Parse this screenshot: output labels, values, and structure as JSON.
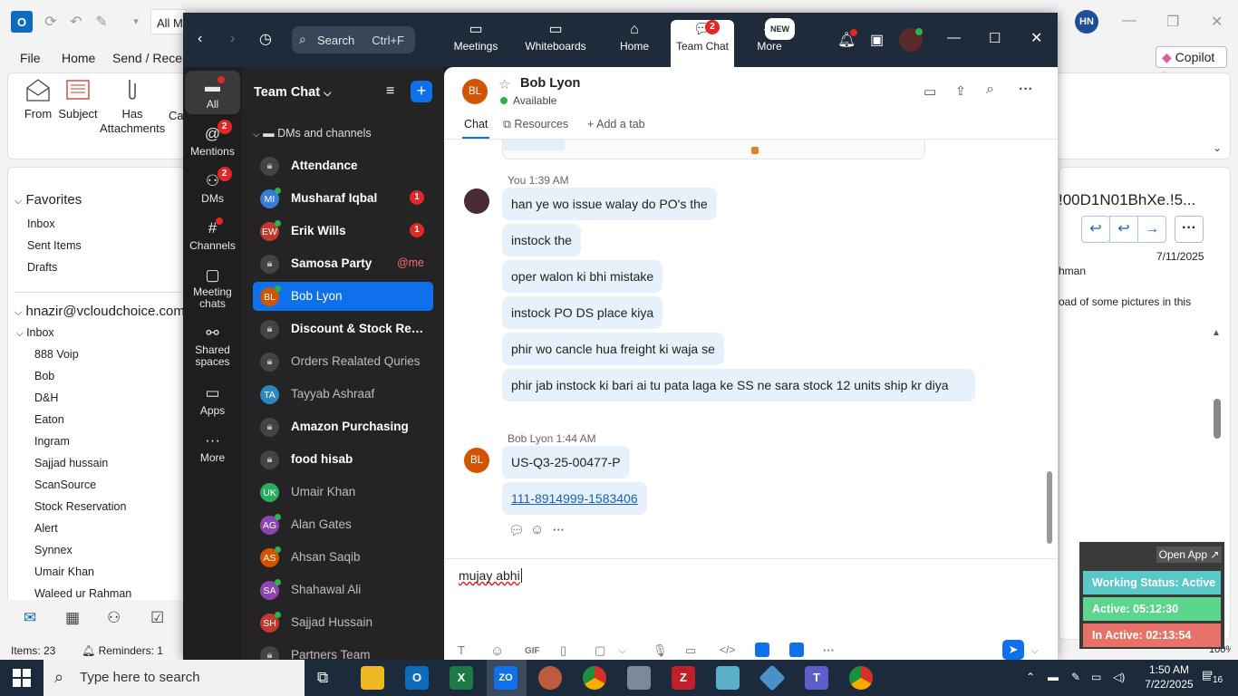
{
  "outlook": {
    "allm_text": "All M",
    "avatar_initials": "HN",
    "menu": [
      "File",
      "Home",
      "Send / Receive"
    ],
    "copilot_label": "Copilot",
    "ribbon": [
      "From",
      "Subject",
      "Has Attachments",
      "Cat"
    ],
    "favorites_label": "Favorites",
    "favorites": [
      "Inbox",
      "Sent Items",
      "Drafts"
    ],
    "account": "hnazir@vcloudchoice.com",
    "inbox_label": "Inbox",
    "folders": [
      "888 Voip",
      "Bob",
      "D&H",
      "Eaton",
      "Ingram",
      "Sajjad hussain",
      "ScanSource",
      "Stock Reservation",
      "Alert",
      "Synnex",
      "Umair Khan",
      "Waleed ur Rahman"
    ],
    "status_items": "Items: 23",
    "status_reminders": "Reminders: 1",
    "status_zoom": "100%",
    "reading_subject": "!00D1N01BhXe.!5...",
    "reading_date": "7/11/2025",
    "reading_from": "hman",
    "reading_snippet": "oad of some pictures in this"
  },
  "zoom": {
    "search_placeholder": "Search",
    "search_shortcut": "Ctrl+F",
    "tabs": [
      {
        "label": "Meetings",
        "icon": "video-icon"
      },
      {
        "label": "Whiteboards",
        "icon": "whiteboard-icon"
      },
      {
        "label": "Home",
        "icon": "home-icon"
      },
      {
        "label": "Team Chat",
        "icon": "chat-icon",
        "badge": "2",
        "active": true
      },
      {
        "label": "More",
        "icon": "more-icon",
        "badge": "NEW"
      }
    ],
    "rail": [
      {
        "label": "All",
        "icon": "chat-bubble-icon"
      },
      {
        "label": "Mentions",
        "icon": "at-icon",
        "badge": "2"
      },
      {
        "label": "DMs",
        "icon": "people-icon",
        "badge": "2"
      },
      {
        "label": "Channels",
        "icon": "hash-icon"
      },
      {
        "label": "Meeting chats",
        "icon": "calendar-icon"
      },
      {
        "label": "Shared spaces",
        "icon": "shared-spaces-icon"
      },
      {
        "label": "Apps",
        "icon": "apps-icon"
      },
      {
        "label": "More",
        "icon": "ellipsis-icon"
      }
    ],
    "list_title": "Team Chat",
    "section_label": "DMs and channels",
    "chats": [
      {
        "name": "Attendance",
        "kind": "channel",
        "bold": true
      },
      {
        "name": "Musharaf Iqbal",
        "initials": "MI",
        "color": "#3a7bd5",
        "bold": true,
        "count": "1"
      },
      {
        "name": "Erik Wills",
        "initials": "EW",
        "color": "#c0392b",
        "bold": true,
        "count": "1"
      },
      {
        "name": "Samosa Party",
        "kind": "channel",
        "bold": true,
        "mention": "@me"
      },
      {
        "name": "Bob Lyon",
        "initials": "BL",
        "color": "#d35400",
        "selected": true
      },
      {
        "name": "Discount & Stock Reservation",
        "kind": "channel",
        "bold": true
      },
      {
        "name": "Orders Realated Quries",
        "kind": "channel",
        "dim": true
      },
      {
        "name": "Tayyab Ashraaf",
        "initials": "TA",
        "color": "#2e86c1"
      },
      {
        "name": "Amazon Purchasing",
        "kind": "channel",
        "bold": true
      },
      {
        "name": "food hisab",
        "kind": "channel",
        "bold": true
      },
      {
        "name": "Umair Khan",
        "initials": "UK",
        "color": "#27ae60"
      },
      {
        "name": "Alan Gates",
        "initials": "AG",
        "color": "#8e44ad"
      },
      {
        "name": "Ahsan Saqib",
        "initials": "AS",
        "color": "#d35400"
      },
      {
        "name": "Shahawal Ali",
        "initials": "SA",
        "color": "#8e44ad"
      },
      {
        "name": "Sajjad Hussain",
        "initials": "SH",
        "color": "#c0392b"
      },
      {
        "name": "Partners Team",
        "kind": "channel",
        "dim": true
      }
    ],
    "contact": {
      "name": "Bob Lyon",
      "initials": "BL",
      "status": "Available"
    },
    "chat_tabs": [
      "Chat",
      "Resources",
      "Add a tab"
    ],
    "me_meta": "You 1:39 AM",
    "my_messages": [
      "han ye wo issue walay do PO's the",
      "instock the",
      "oper walon ki bhi mistake",
      "instock PO DS place kiya",
      "phir wo cancle hua freight ki waja se",
      "phir jab instock ki bari ai tu pata laga ke SS ne sara stock 12 units ship kr diya"
    ],
    "bob_meta": "Bob Lyon 1:44 AM",
    "bob_messages": [
      "US-Q3-25-00477-P"
    ],
    "link_parts": [
      "111-8914999",
      "-",
      "1583406"
    ],
    "composer_text": "mujay abhi"
  },
  "tracker": {
    "open_label": "Open App ↗",
    "working": "Working Status: Active",
    "active": "Active: 05:12:30",
    "inactive": "In Active: 02:13:54",
    "colors": {
      "working": "#5bc8c8",
      "active": "#5cd68c",
      "inactive": "#e8726a"
    }
  },
  "taskbar": {
    "search_placeholder": "Type here to search",
    "time": "1:50 AM",
    "date": "7/22/2025",
    "notif_count": "16"
  }
}
